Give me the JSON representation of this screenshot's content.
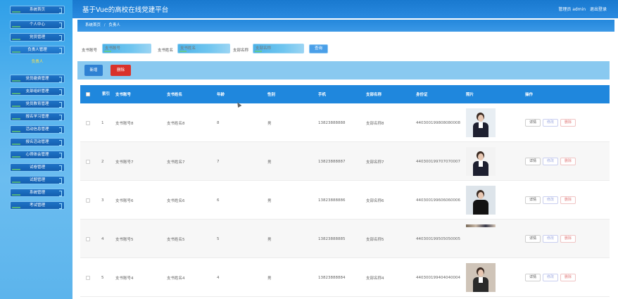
{
  "header": {
    "title": "基于Vue的高校在线党建平台",
    "user_label": "管理员 admin",
    "logout_label": "退出登录"
  },
  "sidebar": {
    "items": [
      {
        "label": "系统首页"
      },
      {
        "label": "个人中心"
      },
      {
        "label": "党员管理"
      },
      {
        "label": "负责人管理"
      },
      {
        "label": "党员缴费管理"
      },
      {
        "label": "支部组织管理"
      },
      {
        "label": "党员教育管理"
      },
      {
        "label": "报名学习管理"
      },
      {
        "label": "活动信息管理"
      },
      {
        "label": "报名活动管理"
      },
      {
        "label": "心得体会管理"
      },
      {
        "label": "试卷管理"
      },
      {
        "label": "试题管理"
      },
      {
        "label": "系统管理"
      },
      {
        "label": "考试管理"
      }
    ],
    "sub_item": "负责人"
  },
  "breadcrumb": {
    "home": "系统首页",
    "separator": "/",
    "current": "负责人"
  },
  "search": {
    "account_label": "支书账号",
    "account_placeholder": "支书账号",
    "name_label": "支书姓名",
    "name_placeholder": "支书姓名",
    "branch_label": "支部名称",
    "branch_placeholder": "支部名称",
    "button_label": "查询"
  },
  "actions": {
    "add_label": "新增",
    "delete_label": "删除"
  },
  "table": {
    "headers": {
      "select": "",
      "index": "索引",
      "account": "支书账号",
      "name": "支书姓名",
      "age": "年龄",
      "gender": "性别",
      "phone": "手机",
      "branch": "支部名称",
      "idcard": "身份证",
      "photo": "照片",
      "ops": "操作"
    },
    "ops_labels": {
      "detail": "详情",
      "edit": "修改",
      "delete": "删除"
    },
    "rows": [
      {
        "index": "1",
        "account": "支书账号8",
        "name": "支书姓名8",
        "age": "8",
        "gender": "男",
        "phone": "13823888888",
        "branch": "支部名称8",
        "idcard": "440300199808080008",
        "photo": "man-suit"
      },
      {
        "index": "2",
        "account": "支书账号7",
        "name": "支书姓名7",
        "age": "7",
        "gender": "男",
        "phone": "13823888887",
        "branch": "支部名称7",
        "idcard": "440300199707070007",
        "photo": "woman-suit"
      },
      {
        "index": "3",
        "account": "支书账号6",
        "name": "支书姓名6",
        "age": "6",
        "gender": "男",
        "phone": "13823888886",
        "branch": "支部名称6",
        "idcard": "440300199606060006",
        "photo": "woman-black"
      },
      {
        "index": "4",
        "account": "支书账号5",
        "name": "支书姓名5",
        "age": "5",
        "gender": "男",
        "phone": "13823888885",
        "branch": "支部名称5",
        "idcard": "440300199505050005",
        "photo": "partial"
      },
      {
        "index": "5",
        "account": "支书账号4",
        "name": "支书姓名4",
        "age": "4",
        "gender": "男",
        "phone": "13823888884",
        "branch": "支部名称4",
        "idcard": "440300199404040004",
        "photo": "woman-office"
      }
    ]
  }
}
